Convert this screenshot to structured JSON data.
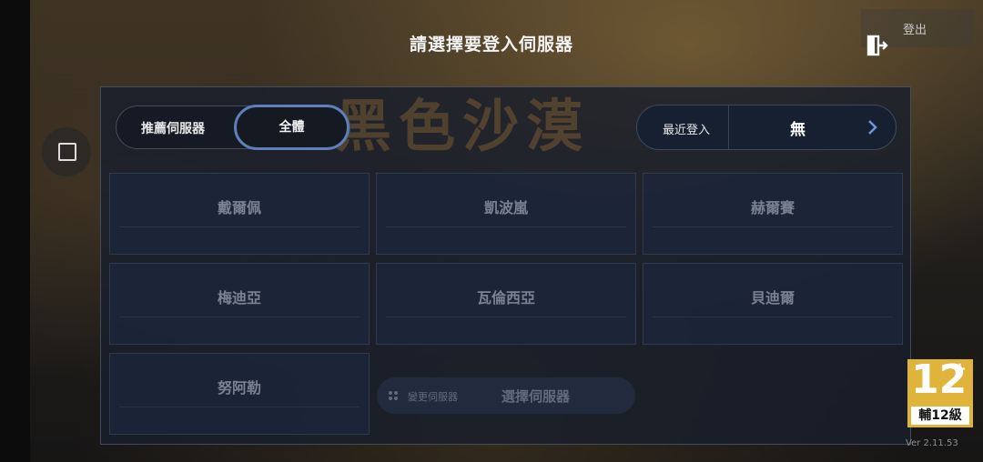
{
  "header": {
    "title": "請選擇要登入伺服器",
    "logout_label": "登出"
  },
  "watermark_text": "黑色沙漠",
  "tabs": {
    "recommended": "推薦伺服器",
    "all": "全體"
  },
  "recent": {
    "label": "最近登入",
    "value": "無"
  },
  "servers": [
    "戴爾佩",
    "凱波嵐",
    "赫爾賽",
    "梅迪亞",
    "瓦倫西亞",
    "貝迪爾",
    "努阿勒"
  ],
  "select_bar": {
    "change_label": "變更伺服器",
    "choose_label": "選擇伺服器"
  },
  "rating": {
    "age": "12",
    "plus": "+",
    "label": "輔12級"
  },
  "version": "Ver 2.11.53",
  "colors": {
    "accent": "#5f7fb6",
    "rating_bg": "#e0b43a"
  }
}
